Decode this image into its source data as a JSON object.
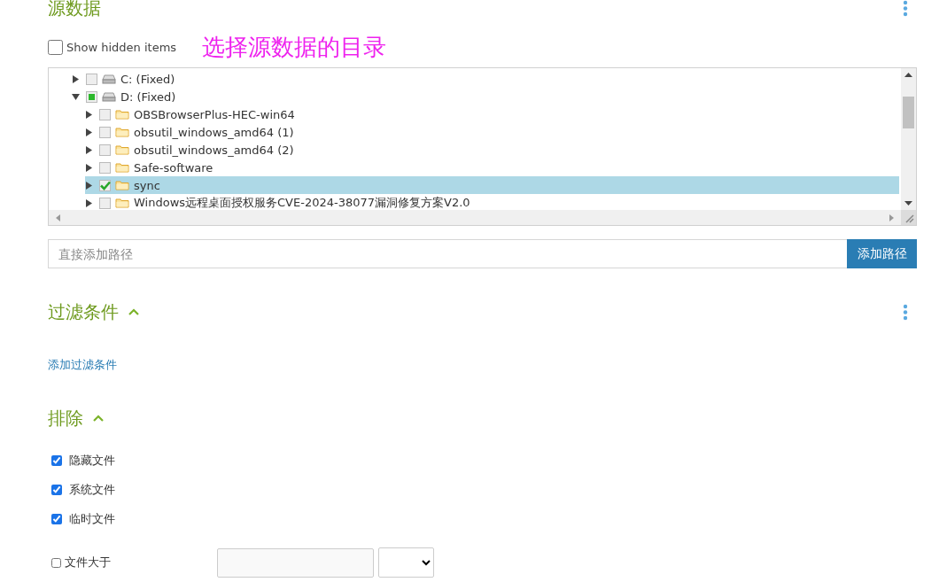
{
  "source": {
    "title": "源数据",
    "show_hidden": {
      "label": "Show hidden items",
      "checked": false
    },
    "annotation": "选择源数据的目录",
    "tree": [
      {
        "label": "C: (Fixed)",
        "kind": "drive",
        "checked": false,
        "partial": false,
        "expanded": false,
        "selected": false
      },
      {
        "label": "D: (Fixed)",
        "kind": "drive",
        "checked": false,
        "partial": true,
        "expanded": true,
        "selected": false,
        "children": [
          {
            "label": "OBSBrowserPlus-HEC-win64",
            "kind": "folder",
            "checked": false,
            "partial": false,
            "expanded": false,
            "selected": false
          },
          {
            "label": "obsutil_windows_amd64 (1)",
            "kind": "folder",
            "checked": false,
            "partial": false,
            "expanded": false,
            "selected": false
          },
          {
            "label": "obsutil_windows_amd64 (2)",
            "kind": "folder",
            "checked": false,
            "partial": false,
            "expanded": false,
            "selected": false
          },
          {
            "label": "Safe-software",
            "kind": "folder",
            "checked": false,
            "partial": false,
            "expanded": false,
            "selected": false
          },
          {
            "label": "sync",
            "kind": "folder",
            "checked": true,
            "partial": false,
            "expanded": false,
            "selected": true
          },
          {
            "label": "Windows远程桌面授权服务CVE-2024-38077漏洞修复方案V2.0",
            "kind": "folder",
            "checked": false,
            "partial": false,
            "expanded": false,
            "selected": false
          }
        ]
      }
    ],
    "path": {
      "placeholder": "直接添加路径",
      "button": "添加路径"
    }
  },
  "filter": {
    "title": "过滤条件",
    "expanded": true,
    "link": "添加过滤条件"
  },
  "exclude": {
    "title": "排除",
    "expanded": true,
    "options": [
      {
        "label": "隐藏文件",
        "checked": true
      },
      {
        "label": "系统文件",
        "checked": true
      },
      {
        "label": "临时文件",
        "checked": true
      }
    ],
    "size": {
      "label": "文件大于",
      "checked": false
    }
  }
}
